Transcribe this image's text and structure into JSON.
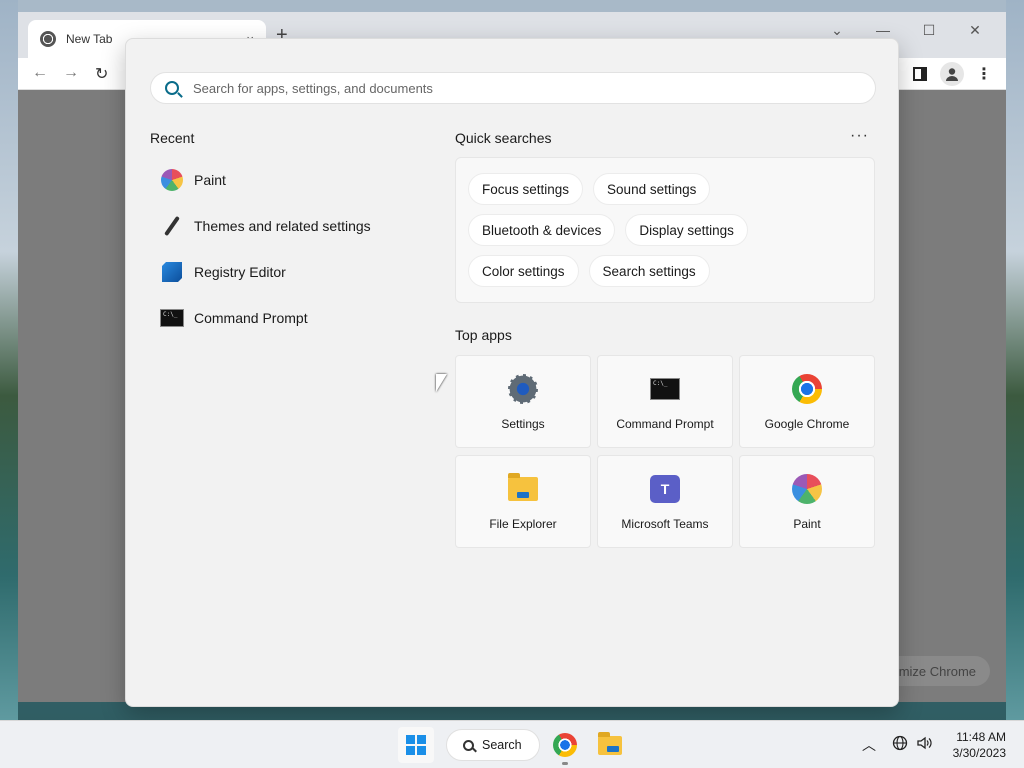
{
  "browser": {
    "tab_title": "New Tab",
    "tab_close": "×",
    "new_tab": "+",
    "customize_label": "mize Chrome"
  },
  "start_menu": {
    "search": {
      "placeholder": "Search for apps, settings, and documents"
    },
    "recent": {
      "title": "Recent",
      "items": [
        {
          "label": "Paint",
          "icon": "paint-icon"
        },
        {
          "label": "Themes and related settings",
          "icon": "brush-icon"
        },
        {
          "label": "Registry Editor",
          "icon": "registry-editor-icon"
        },
        {
          "label": "Command Prompt",
          "icon": "command-prompt-icon"
        }
      ]
    },
    "quick_searches": {
      "title": "Quick searches",
      "more": "···",
      "chips": [
        "Focus settings",
        "Sound settings",
        "Bluetooth & devices",
        "Display settings",
        "Color settings",
        "Search settings"
      ]
    },
    "top_apps": {
      "title": "Top apps",
      "apps": [
        {
          "label": "Settings",
          "icon": "settings-gear-icon"
        },
        {
          "label": "Command Prompt",
          "icon": "command-prompt-icon"
        },
        {
          "label": "Google Chrome",
          "icon": "chrome-icon"
        },
        {
          "label": "File Explorer",
          "icon": "file-explorer-icon"
        },
        {
          "label": "Microsoft Teams",
          "icon": "teams-icon"
        },
        {
          "label": "Paint",
          "icon": "paint-icon"
        }
      ]
    }
  },
  "taskbar": {
    "search_label": "Search",
    "time": "11:48 AM",
    "date": "3/30/2023"
  },
  "colors": {
    "accent": "#1a8fe8",
    "search_icon": "#0a6c8a"
  }
}
